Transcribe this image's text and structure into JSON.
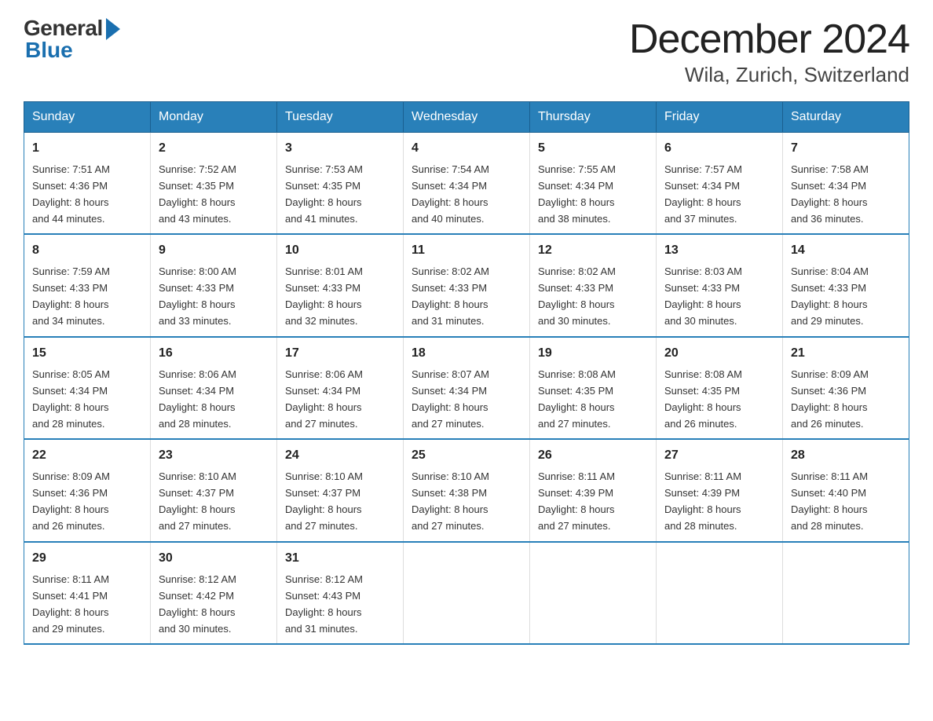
{
  "header": {
    "logo": {
      "general": "General",
      "blue": "Blue"
    },
    "title": "December 2024",
    "subtitle": "Wila, Zurich, Switzerland"
  },
  "days_of_week": [
    "Sunday",
    "Monday",
    "Tuesday",
    "Wednesday",
    "Thursday",
    "Friday",
    "Saturday"
  ],
  "weeks": [
    [
      {
        "day": "1",
        "sunrise": "7:51 AM",
        "sunset": "4:36 PM",
        "daylight": "8 hours and 44 minutes."
      },
      {
        "day": "2",
        "sunrise": "7:52 AM",
        "sunset": "4:35 PM",
        "daylight": "8 hours and 43 minutes."
      },
      {
        "day": "3",
        "sunrise": "7:53 AM",
        "sunset": "4:35 PM",
        "daylight": "8 hours and 41 minutes."
      },
      {
        "day": "4",
        "sunrise": "7:54 AM",
        "sunset": "4:34 PM",
        "daylight": "8 hours and 40 minutes."
      },
      {
        "day": "5",
        "sunrise": "7:55 AM",
        "sunset": "4:34 PM",
        "daylight": "8 hours and 38 minutes."
      },
      {
        "day": "6",
        "sunrise": "7:57 AM",
        "sunset": "4:34 PM",
        "daylight": "8 hours and 37 minutes."
      },
      {
        "day": "7",
        "sunrise": "7:58 AM",
        "sunset": "4:34 PM",
        "daylight": "8 hours and 36 minutes."
      }
    ],
    [
      {
        "day": "8",
        "sunrise": "7:59 AM",
        "sunset": "4:33 PM",
        "daylight": "8 hours and 34 minutes."
      },
      {
        "day": "9",
        "sunrise": "8:00 AM",
        "sunset": "4:33 PM",
        "daylight": "8 hours and 33 minutes."
      },
      {
        "day": "10",
        "sunrise": "8:01 AM",
        "sunset": "4:33 PM",
        "daylight": "8 hours and 32 minutes."
      },
      {
        "day": "11",
        "sunrise": "8:02 AM",
        "sunset": "4:33 PM",
        "daylight": "8 hours and 31 minutes."
      },
      {
        "day": "12",
        "sunrise": "8:02 AM",
        "sunset": "4:33 PM",
        "daylight": "8 hours and 30 minutes."
      },
      {
        "day": "13",
        "sunrise": "8:03 AM",
        "sunset": "4:33 PM",
        "daylight": "8 hours and 30 minutes."
      },
      {
        "day": "14",
        "sunrise": "8:04 AM",
        "sunset": "4:33 PM",
        "daylight": "8 hours and 29 minutes."
      }
    ],
    [
      {
        "day": "15",
        "sunrise": "8:05 AM",
        "sunset": "4:34 PM",
        "daylight": "8 hours and 28 minutes."
      },
      {
        "day": "16",
        "sunrise": "8:06 AM",
        "sunset": "4:34 PM",
        "daylight": "8 hours and 28 minutes."
      },
      {
        "day": "17",
        "sunrise": "8:06 AM",
        "sunset": "4:34 PM",
        "daylight": "8 hours and 27 minutes."
      },
      {
        "day": "18",
        "sunrise": "8:07 AM",
        "sunset": "4:34 PM",
        "daylight": "8 hours and 27 minutes."
      },
      {
        "day": "19",
        "sunrise": "8:08 AM",
        "sunset": "4:35 PM",
        "daylight": "8 hours and 27 minutes."
      },
      {
        "day": "20",
        "sunrise": "8:08 AM",
        "sunset": "4:35 PM",
        "daylight": "8 hours and 26 minutes."
      },
      {
        "day": "21",
        "sunrise": "8:09 AM",
        "sunset": "4:36 PM",
        "daylight": "8 hours and 26 minutes."
      }
    ],
    [
      {
        "day": "22",
        "sunrise": "8:09 AM",
        "sunset": "4:36 PM",
        "daylight": "8 hours and 26 minutes."
      },
      {
        "day": "23",
        "sunrise": "8:10 AM",
        "sunset": "4:37 PM",
        "daylight": "8 hours and 27 minutes."
      },
      {
        "day": "24",
        "sunrise": "8:10 AM",
        "sunset": "4:37 PM",
        "daylight": "8 hours and 27 minutes."
      },
      {
        "day": "25",
        "sunrise": "8:10 AM",
        "sunset": "4:38 PM",
        "daylight": "8 hours and 27 minutes."
      },
      {
        "day": "26",
        "sunrise": "8:11 AM",
        "sunset": "4:39 PM",
        "daylight": "8 hours and 27 minutes."
      },
      {
        "day": "27",
        "sunrise": "8:11 AM",
        "sunset": "4:39 PM",
        "daylight": "8 hours and 28 minutes."
      },
      {
        "day": "28",
        "sunrise": "8:11 AM",
        "sunset": "4:40 PM",
        "daylight": "8 hours and 28 minutes."
      }
    ],
    [
      {
        "day": "29",
        "sunrise": "8:11 AM",
        "sunset": "4:41 PM",
        "daylight": "8 hours and 29 minutes."
      },
      {
        "day": "30",
        "sunrise": "8:12 AM",
        "sunset": "4:42 PM",
        "daylight": "8 hours and 30 minutes."
      },
      {
        "day": "31",
        "sunrise": "8:12 AM",
        "sunset": "4:43 PM",
        "daylight": "8 hours and 31 minutes."
      },
      null,
      null,
      null,
      null
    ]
  ],
  "labels": {
    "sunrise": "Sunrise:",
    "sunset": "Sunset:",
    "daylight": "Daylight:"
  }
}
